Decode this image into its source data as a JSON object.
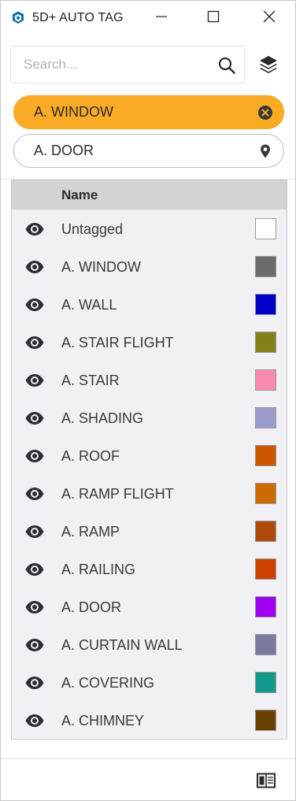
{
  "window": {
    "title": "5D+ AUTO TAG",
    "icons": [
      "app-logo-icon",
      "minimize-icon",
      "maximize-icon",
      "close-icon"
    ]
  },
  "search": {
    "placeholder": "Search...",
    "value": "",
    "icon": "search-icon"
  },
  "toolbar": {
    "layers_icon": "layers-icon"
  },
  "chips": [
    {
      "label": "A. WINDOW",
      "icon": "remove-circle-icon",
      "color": "#f9ab26"
    },
    {
      "label": "A. DOOR",
      "icon": "location-pin-icon",
      "color": "#ffffff"
    }
  ],
  "table": {
    "header": {
      "name": "Name"
    },
    "rows": [
      {
        "label": "Untagged",
        "color": "#ffffff"
      },
      {
        "label": "A. WINDOW",
        "color": "#6b6b6b"
      },
      {
        "label": "A. WALL",
        "color": "#0000c8"
      },
      {
        "label": "A. STAIR FLIGHT",
        "color": "#857f1a"
      },
      {
        "label": "A. STAIR",
        "color": "#f98aae"
      },
      {
        "label": "A. SHADING",
        "color": "#9b9bcd"
      },
      {
        "label": "A. ROOF",
        "color": "#cc5500"
      },
      {
        "label": "A. RAMP FLIGHT",
        "color": "#cc6a00"
      },
      {
        "label": "A. RAMP",
        "color": "#b04a0a"
      },
      {
        "label": "A. RAILING",
        "color": "#cc4000"
      },
      {
        "label": "A. DOOR",
        "color": "#a000f0"
      },
      {
        "label": "A. CURTAIN WALL",
        "color": "#7a7a9e"
      },
      {
        "label": "A. COVERING",
        "color": "#129a8a"
      },
      {
        "label": "A. CHIMNEY",
        "color": "#6a4000"
      }
    ]
  },
  "footer": {
    "icon": "panel-layout-icon"
  },
  "colors": {
    "accent": "#f9ab26",
    "header_bg": "#d2d2d7",
    "list_bg": "#f0f0f5"
  }
}
